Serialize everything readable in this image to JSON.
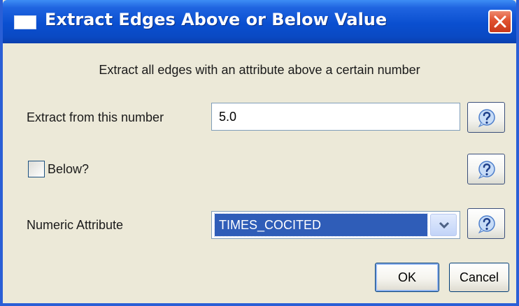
{
  "window": {
    "title": "Extract Edges Above or Below Value"
  },
  "description": "Extract all edges with an attribute above a certain number",
  "number_field": {
    "label": "Extract from this number",
    "value": "5.0"
  },
  "below_checkbox": {
    "label": "Below?",
    "checked": false
  },
  "attribute_select": {
    "label": "Numeric Attribute",
    "selected": "TIMES_COCITED"
  },
  "buttons": {
    "ok": "OK",
    "cancel": "Cancel"
  },
  "icons": {
    "window": "window-icon",
    "close": "close-icon",
    "help": "help-icon",
    "dropdown": "chevron-down-icon"
  },
  "colors": {
    "titlebar": "#0a4fd0",
    "close_button": "#e0512e",
    "dialog_background": "#ece9d8",
    "selection": "#2f5db8"
  }
}
